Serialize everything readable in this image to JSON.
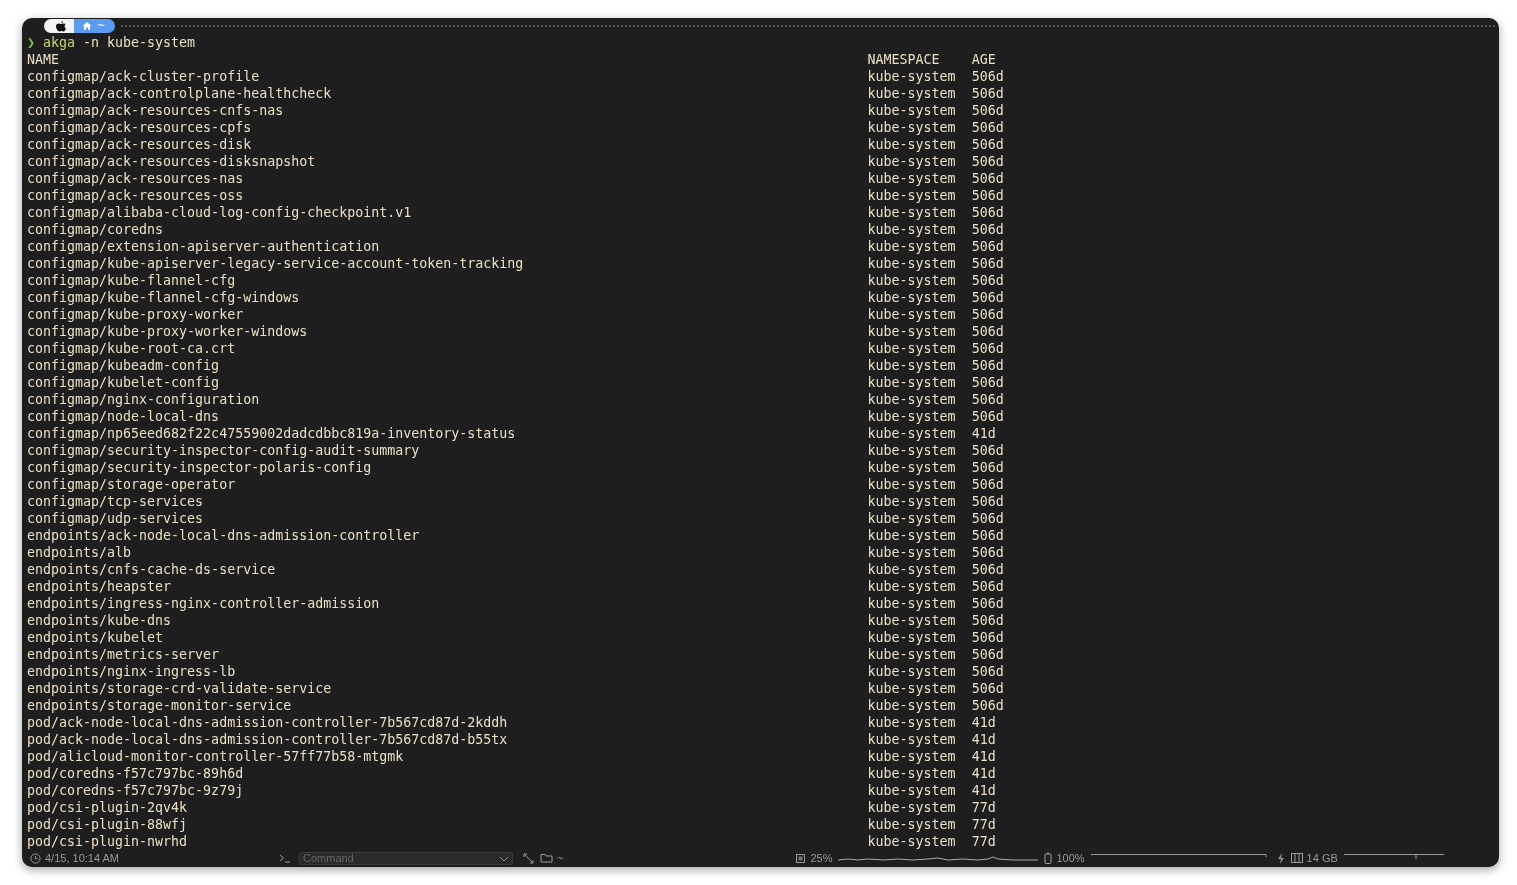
{
  "header": {
    "path": "~"
  },
  "prompt": {
    "symbol": "❯",
    "command": "akga",
    "args": "-n kube-system"
  },
  "table": {
    "columns": [
      "NAME",
      "NAMESPACE",
      "AGE"
    ],
    "rows": [
      [
        "configmap/ack-cluster-profile",
        "kube-system",
        "506d"
      ],
      [
        "configmap/ack-controlplane-healthcheck",
        "kube-system",
        "506d"
      ],
      [
        "configmap/ack-resources-cnfs-nas",
        "kube-system",
        "506d"
      ],
      [
        "configmap/ack-resources-cpfs",
        "kube-system",
        "506d"
      ],
      [
        "configmap/ack-resources-disk",
        "kube-system",
        "506d"
      ],
      [
        "configmap/ack-resources-disksnapshot",
        "kube-system",
        "506d"
      ],
      [
        "configmap/ack-resources-nas",
        "kube-system",
        "506d"
      ],
      [
        "configmap/ack-resources-oss",
        "kube-system",
        "506d"
      ],
      [
        "configmap/alibaba-cloud-log-config-checkpoint.v1",
        "kube-system",
        "506d"
      ],
      [
        "configmap/coredns",
        "kube-system",
        "506d"
      ],
      [
        "configmap/extension-apiserver-authentication",
        "kube-system",
        "506d"
      ],
      [
        "configmap/kube-apiserver-legacy-service-account-token-tracking",
        "kube-system",
        "506d"
      ],
      [
        "configmap/kube-flannel-cfg",
        "kube-system",
        "506d"
      ],
      [
        "configmap/kube-flannel-cfg-windows",
        "kube-system",
        "506d"
      ],
      [
        "configmap/kube-proxy-worker",
        "kube-system",
        "506d"
      ],
      [
        "configmap/kube-proxy-worker-windows",
        "kube-system",
        "506d"
      ],
      [
        "configmap/kube-root-ca.crt",
        "kube-system",
        "506d"
      ],
      [
        "configmap/kubeadm-config",
        "kube-system",
        "506d"
      ],
      [
        "configmap/kubelet-config",
        "kube-system",
        "506d"
      ],
      [
        "configmap/nginx-configuration",
        "kube-system",
        "506d"
      ],
      [
        "configmap/node-local-dns",
        "kube-system",
        "506d"
      ],
      [
        "configmap/np65eed682f22c47559002dadcdbbc819a-inventory-status",
        "kube-system",
        "41d"
      ],
      [
        "configmap/security-inspector-config-audit-summary",
        "kube-system",
        "506d"
      ],
      [
        "configmap/security-inspector-polaris-config",
        "kube-system",
        "506d"
      ],
      [
        "configmap/storage-operator",
        "kube-system",
        "506d"
      ],
      [
        "configmap/tcp-services",
        "kube-system",
        "506d"
      ],
      [
        "configmap/udp-services",
        "kube-system",
        "506d"
      ],
      [
        "endpoints/ack-node-local-dns-admission-controller",
        "kube-system",
        "506d"
      ],
      [
        "endpoints/alb",
        "kube-system",
        "506d"
      ],
      [
        "endpoints/cnfs-cache-ds-service",
        "kube-system",
        "506d"
      ],
      [
        "endpoints/heapster",
        "kube-system",
        "506d"
      ],
      [
        "endpoints/ingress-nginx-controller-admission",
        "kube-system",
        "506d"
      ],
      [
        "endpoints/kube-dns",
        "kube-system",
        "506d"
      ],
      [
        "endpoints/kubelet",
        "kube-system",
        "506d"
      ],
      [
        "endpoints/metrics-server",
        "kube-system",
        "506d"
      ],
      [
        "endpoints/nginx-ingress-lb",
        "kube-system",
        "506d"
      ],
      [
        "endpoints/storage-crd-validate-service",
        "kube-system",
        "506d"
      ],
      [
        "endpoints/storage-monitor-service",
        "kube-system",
        "506d"
      ],
      [
        "pod/ack-node-local-dns-admission-controller-7b567cd87d-2kddh",
        "kube-system",
        "41d"
      ],
      [
        "pod/ack-node-local-dns-admission-controller-7b567cd87d-b55tx",
        "kube-system",
        "41d"
      ],
      [
        "pod/alicloud-monitor-controller-57ff77b58-mtgmk",
        "kube-system",
        "41d"
      ],
      [
        "pod/coredns-f57c797bc-89h6d",
        "kube-system",
        "41d"
      ],
      [
        "pod/coredns-f57c797bc-9z79j",
        "kube-system",
        "41d"
      ],
      [
        "pod/csi-plugin-2qv4k",
        "kube-system",
        "77d"
      ],
      [
        "pod/csi-plugin-88wfj",
        "kube-system",
        "77d"
      ],
      [
        "pod/csi-plugin-nwrhd",
        "kube-system",
        "77d"
      ]
    ]
  },
  "status_bar": {
    "time": "4/15, 10:14 AM",
    "command_placeholder": "Command",
    "directory": "~",
    "cpu": "25%",
    "battery": "100%",
    "memory": "14 GB"
  }
}
